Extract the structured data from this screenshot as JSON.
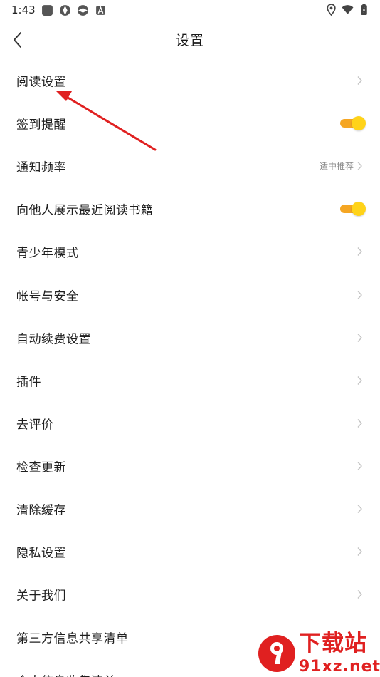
{
  "status_bar": {
    "time": "1:43"
  },
  "header": {
    "title": "设置"
  },
  "settings": [
    {
      "label": "阅读设置",
      "control": "chevron"
    },
    {
      "label": "签到提醒",
      "control": "toggle",
      "on": true
    },
    {
      "label": "通知频率",
      "control": "chevron",
      "value": "适中推荐"
    },
    {
      "label": "向他人展示最近阅读书籍",
      "control": "toggle",
      "on": true
    },
    {
      "label": "青少年模式",
      "control": "chevron"
    },
    {
      "label": "帐号与安全",
      "control": "chevron"
    },
    {
      "label": "自动续费设置",
      "control": "chevron"
    },
    {
      "label": "插件",
      "control": "chevron"
    },
    {
      "label": "去评价",
      "control": "chevron"
    },
    {
      "label": "检查更新",
      "control": "chevron"
    },
    {
      "label": "清除缓存",
      "control": "chevron"
    },
    {
      "label": "隐私设置",
      "control": "chevron"
    },
    {
      "label": "关于我们",
      "control": "chevron"
    },
    {
      "label": "第三方信息共享清单",
      "control": "none"
    },
    {
      "label": "个人信息收集清单",
      "control": "none"
    }
  ],
  "watermark": {
    "brand": "下载站",
    "url": "91xz.net"
  },
  "colors": {
    "toggle_track": "#f5a623",
    "toggle_thumb": "#ffd319",
    "annotation": "#e02020"
  }
}
